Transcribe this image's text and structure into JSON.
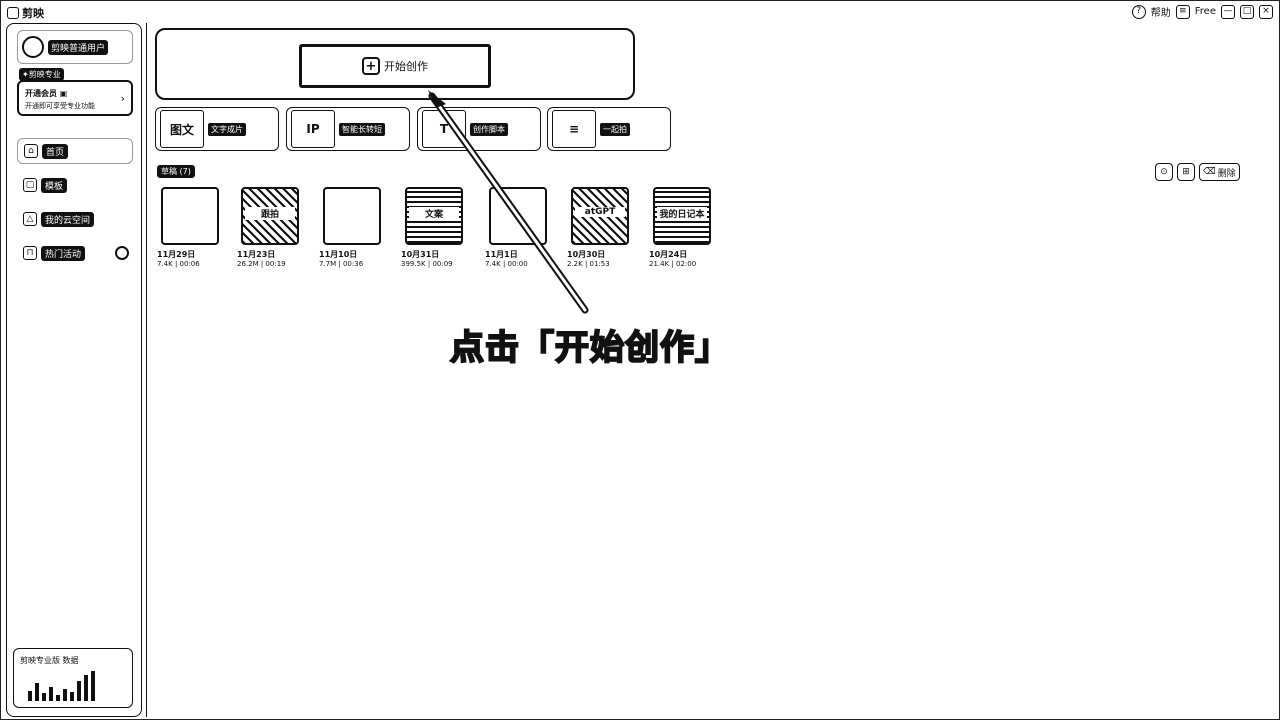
{
  "titlebar": {
    "app_name": "剪映",
    "help_label": "帮助",
    "plan_label": "Free",
    "controls": [
      "?",
      "≡",
      "—",
      "□",
      "×"
    ]
  },
  "sidebar": {
    "username": "剪映普通用户",
    "vip_tag": "✦剪映专业",
    "member": {
      "title": "开通会员 ▣",
      "subtitle": "开通即可享受专业功能",
      "arrow": "›"
    },
    "nav": [
      {
        "icon": "⌂",
        "label": "首页"
      },
      {
        "icon": "▢",
        "label": "模板"
      },
      {
        "icon": "△",
        "label": "我的云空间"
      },
      {
        "icon": "⊓",
        "label": "热门活动"
      }
    ],
    "promo_title": "剪映专业版 数据"
  },
  "hero": {
    "start_icon": "+",
    "start_label": "开始创作"
  },
  "tools": [
    {
      "thumb": "图文",
      "label": "文字成片"
    },
    {
      "thumb": "IP",
      "label": "智能长转短"
    },
    {
      "thumb": "T",
      "label": "创作脚本"
    },
    {
      "thumb": "≡",
      "label": "一起拍"
    }
  ],
  "drafts": {
    "title": "草稿 (7)",
    "action_icons": [
      "⊙",
      "⊞",
      "⌫"
    ],
    "action_label": "删除",
    "items": [
      {
        "date": "11月29日",
        "meta": "7.4K | 00:06",
        "thumb_text": ""
      },
      {
        "date": "11月23日",
        "meta": "26.2M | 00:19",
        "thumb_text": "跟拍"
      },
      {
        "date": "11月10日",
        "meta": "7.7M | 00:36",
        "thumb_text": ""
      },
      {
        "date": "10月31日",
        "meta": "399.5K | 00:09",
        "thumb_text": "文案"
      },
      {
        "date": "11月1日",
        "meta": "7.4K | 00:00",
        "thumb_text": ""
      },
      {
        "date": "10月30日",
        "meta": "2.2K | 01:53",
        "thumb_text": "atGPT"
      },
      {
        "date": "10月24日",
        "meta": "21.4K | 02:00",
        "thumb_text": "我的日记本"
      }
    ]
  },
  "annotation": {
    "callout": "点击「开始创作」"
  }
}
